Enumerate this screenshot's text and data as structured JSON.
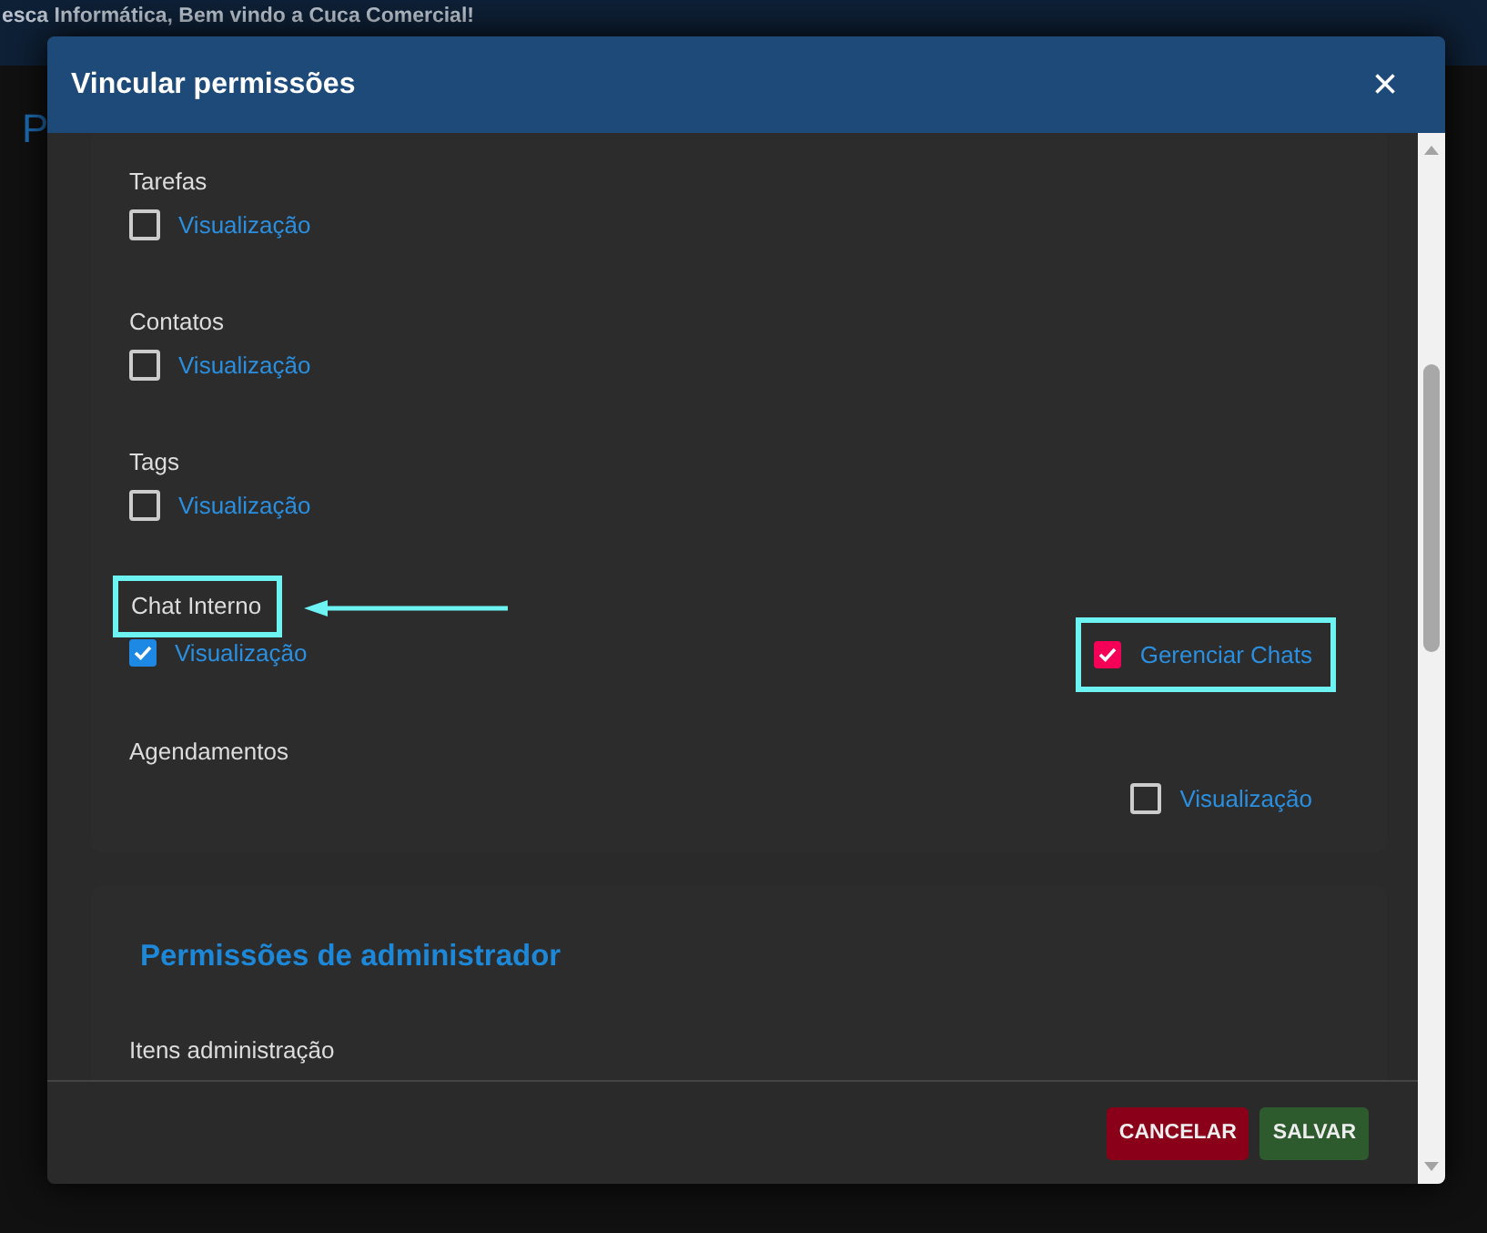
{
  "top_bar": {
    "text": "esca Informática, Bem vindo a Cuca Comercial!"
  },
  "page": {
    "title": "P"
  },
  "dialog": {
    "title": "Vincular permissões",
    "close": "×",
    "sections": [
      {
        "title": "Tarefas",
        "highlighted": false,
        "items": [
          {
            "label": "Visualização",
            "checked": false,
            "kind": "left",
            "highlighted": false
          }
        ]
      },
      {
        "title": "Contatos",
        "highlighted": false,
        "items": [
          {
            "label": "Visualização",
            "checked": false,
            "kind": "left",
            "highlighted": false
          }
        ]
      },
      {
        "title": "Tags",
        "highlighted": false,
        "items": [
          {
            "label": "Visualização",
            "checked": false,
            "kind": "left",
            "highlighted": false
          }
        ]
      },
      {
        "title": "Chat Interno",
        "highlighted": true,
        "items": [
          {
            "label": "Visualização",
            "checked": true,
            "kind": "left",
            "highlighted": false,
            "color": "#1e88e5"
          },
          {
            "label": "Gerenciar Chats",
            "checked": true,
            "kind": "right",
            "highlighted": true,
            "color": "#f50057"
          }
        ]
      },
      {
        "title": "Agendamentos",
        "highlighted": false,
        "items": [
          {
            "label": "Visualização",
            "checked": false,
            "kind": "right",
            "highlighted": false
          }
        ]
      }
    ],
    "admin": {
      "heading": "Permissões de administrador",
      "group_title": "Itens administração"
    },
    "buttons": [
      {
        "label": "CANCELAR",
        "kind": "cancel"
      },
      {
        "label": "SALVAR",
        "kind": "save"
      }
    ]
  }
}
